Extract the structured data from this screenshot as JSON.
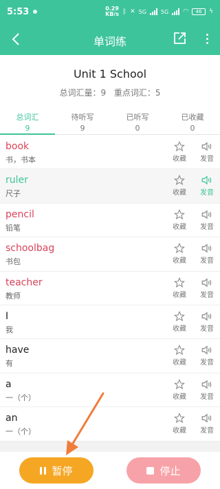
{
  "status_bar": {
    "time": "5:53",
    "speed_value": "0.29",
    "speed_unit": "KB/s",
    "network_1": "5G",
    "network_2": "5G",
    "battery": "46"
  },
  "nav": {
    "title": "单词练",
    "back_icon": "chevron-left-icon",
    "share_icon": "share-icon",
    "more_icon": "more-vertical-icon"
  },
  "header": {
    "unit_title": "Unit 1 School",
    "total_label": "总词汇量：9",
    "key_label": "重点词汇：5"
  },
  "tabs": [
    {
      "label": "总词汇",
      "count": "9"
    },
    {
      "label": "待听写",
      "count": "9"
    },
    {
      "label": "已听写",
      "count": "0"
    },
    {
      "label": "已收藏",
      "count": "0"
    }
  ],
  "actions": {
    "favorite_label": "收藏",
    "sound_label": "发音"
  },
  "words": [
    {
      "en": "book",
      "cn": "书，书本",
      "style": "red"
    },
    {
      "en": "ruler",
      "cn": "尺子",
      "style": "green"
    },
    {
      "en": "pencil",
      "cn": "铅笔",
      "style": "red"
    },
    {
      "en": "schoolbag",
      "cn": "书包",
      "style": "red"
    },
    {
      "en": "teacher",
      "cn": "教师",
      "style": "red"
    },
    {
      "en": "I",
      "cn": "我",
      "style": "normal"
    },
    {
      "en": "have",
      "cn": "有",
      "style": "normal"
    },
    {
      "en": "a",
      "cn": "一（个）",
      "style": "normal"
    },
    {
      "en": "an",
      "cn": "一（个）",
      "style": "normal"
    }
  ],
  "bottom": {
    "pause_label": "暂停",
    "stop_label": "停止"
  },
  "colors": {
    "accent": "#3ec49a",
    "key_word": "#d9435a",
    "pause": "#f5a623",
    "stop": "#f7a2a8",
    "arrow": "#f07c3a"
  }
}
